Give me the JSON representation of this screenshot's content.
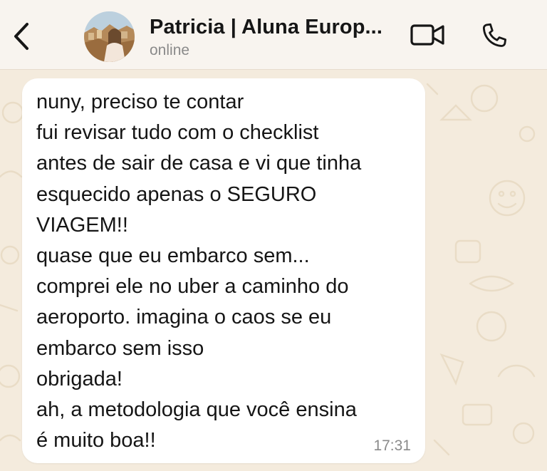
{
  "header": {
    "contact_name": "Patricia | Aluna Europ...",
    "status": "online",
    "icons": {
      "back": "chevron-left-icon",
      "video": "video-camera-icon",
      "call": "phone-icon"
    },
    "accent_color": "#161616"
  },
  "chat": {
    "wallpaper_color": "#f4ebdd",
    "messages": [
      {
        "direction": "incoming",
        "text": "nuny, preciso te contar\nfui revisar tudo com o checklist\nantes de sair de casa e vi que tinha\nesquecido apenas o SEGURO\nVIAGEM!!\nquase que eu embarco sem...\ncomprei ele no uber a caminho do\naeroporto. imagina o caos se eu\nembarco sem isso\nobrigada!\nah, a metodologia que você ensina\né muito boa!!",
        "time": "17:31"
      }
    ]
  }
}
